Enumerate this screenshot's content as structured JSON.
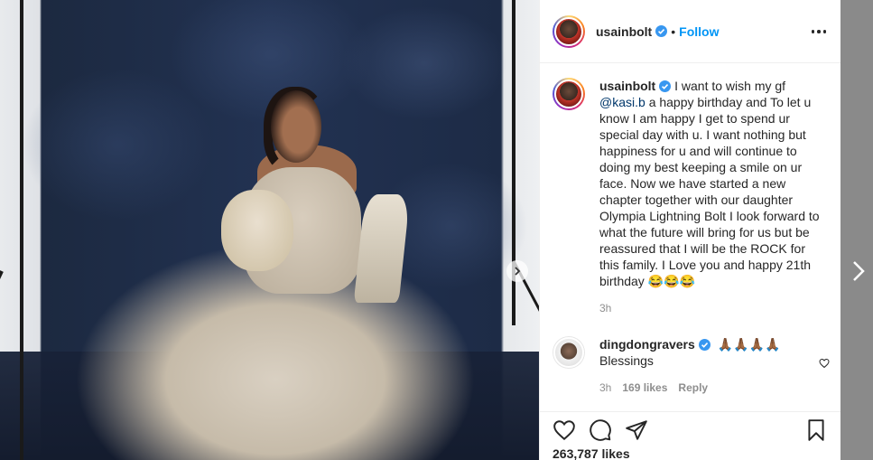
{
  "post": {
    "username": "usainbolt",
    "separator": "•",
    "follow_label": "Follow",
    "caption_mention": "@kasi.b",
    "caption_before": "I want to wish my gf",
    "caption_after": "a happy birthday and To let u know I am happy I get to spend ur special day with u. I want nothing but happiness for u and will continue to doing my best keeping a smile on ur face. Now we have started a new chapter together with our daughter Olympia Lightning Bolt I look forward to what the future will bring for us but be reassured that I will be the ROCK for this family. I Love you and happy 21th birthday 😂😂😂",
    "time": "3h"
  },
  "comment": {
    "username": "dingdongravers",
    "emoji": "🙏🏾🙏🏾🙏🏾🙏🏾",
    "text": "Blessings",
    "time": "3h",
    "likes": "169 likes",
    "reply_label": "Reply"
  },
  "likes_count": "263,787 likes",
  "colors": {
    "accent": "#0095f6",
    "text": "#262626",
    "muted": "#8e8e8e",
    "mention": "#00376b"
  },
  "icons": [
    "verified-icon",
    "more-icon",
    "heart-icon",
    "comment-icon",
    "share-icon",
    "bookmark-icon",
    "chevron-right-icon"
  ]
}
